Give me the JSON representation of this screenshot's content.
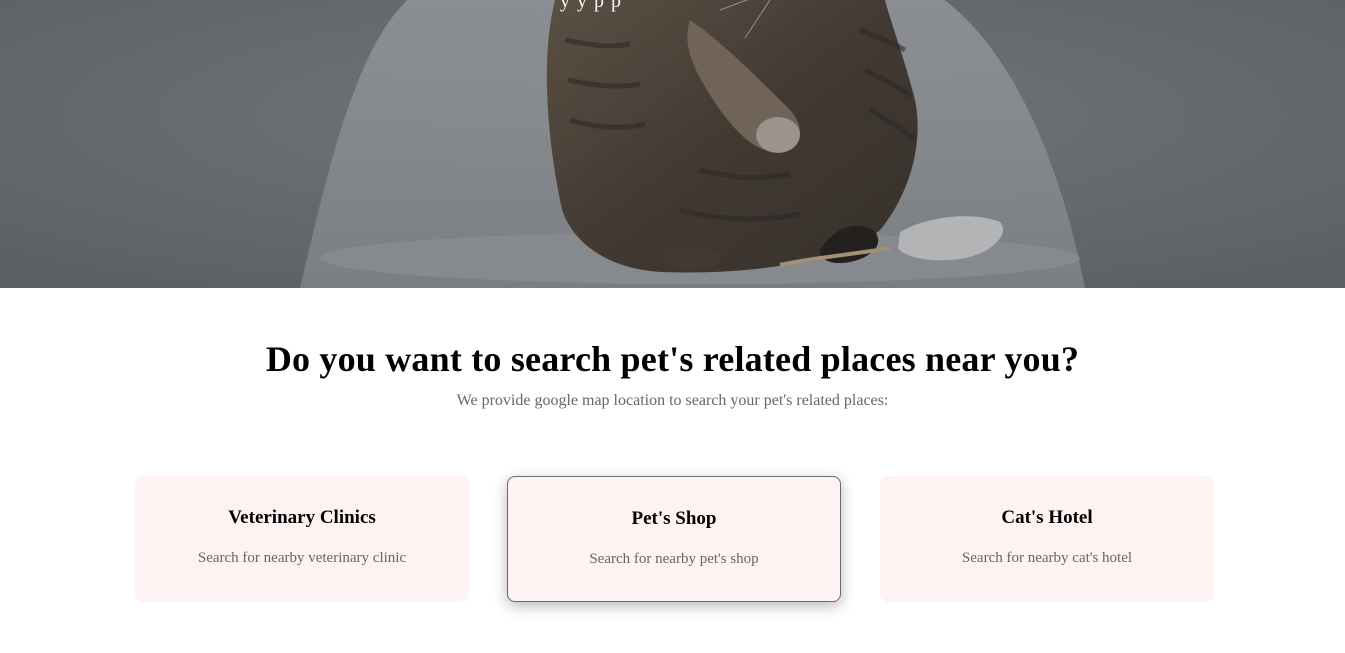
{
  "hero": {
    "image_alt": "Tabby cat sitting on a white chair",
    "overlay_text_fragment": "y          y           p       p",
    "colors": {
      "overlay": "#7a7e81",
      "chair": "#c4c6c8",
      "cat": "#5a4a3a"
    }
  },
  "section": {
    "title": "Do you want to search pet's related places near you?",
    "subtitle": "We provide google map location to search your pet's related places:"
  },
  "cards": [
    {
      "title": "Veterinary Clinics",
      "description": "Search for nearby veterinary clinic",
      "active": false
    },
    {
      "title": "Pet's Shop",
      "description": "Search for nearby pet's shop",
      "active": true
    },
    {
      "title": "Cat's Hotel",
      "description": "Search for nearby cat's hotel",
      "active": false
    }
  ],
  "colors": {
    "card_background": "#fff2f2",
    "title_text": "#000000",
    "muted_text": "#666666",
    "active_border": "#6b6b6b"
  }
}
